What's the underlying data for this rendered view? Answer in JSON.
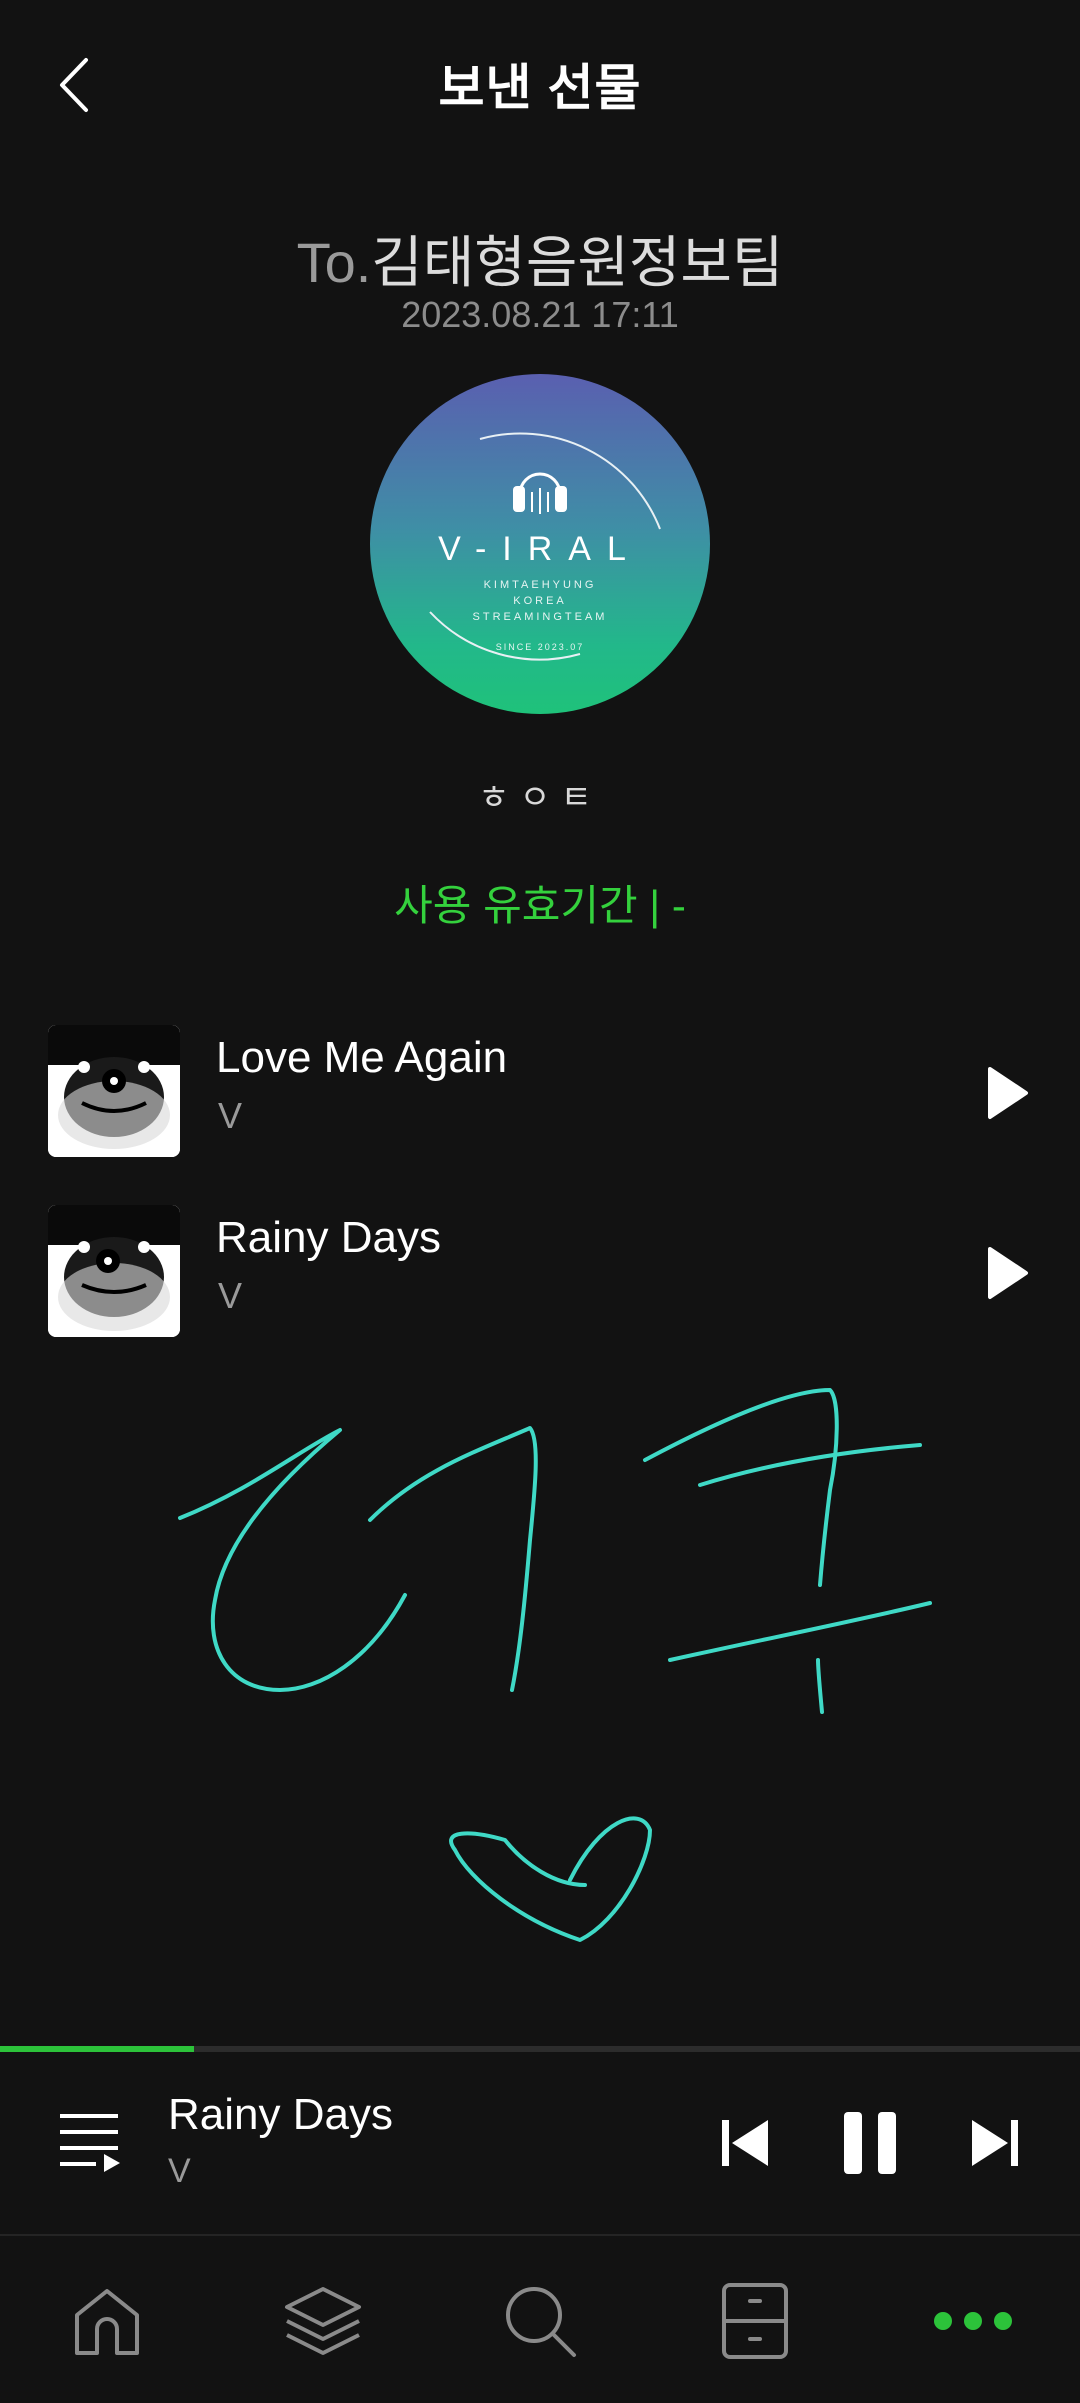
{
  "header": {
    "title": "보낸 선물"
  },
  "gift": {
    "to_prefix": "To.",
    "recipient": "김태형음원정보팀",
    "date": "2023.08.21 17:11",
    "sender": "ㅎㅇㅌ",
    "validity": "사용 유효기간 |  -"
  },
  "logo": {
    "brand": "V-IRAL",
    "line1": "KIMTAEHYUNG",
    "line2": "KOREA",
    "line3": "STREAMINGTEAM",
    "since": "SINCE 2023.07"
  },
  "tracks": [
    {
      "title": "Love Me Again",
      "artist": "V"
    },
    {
      "title": "Rainy Days",
      "artist": "V"
    }
  ],
  "player": {
    "title": "Rainy Days",
    "artist": "V",
    "progress": 0.18,
    "state": "playing"
  },
  "colors": {
    "accent": "#2cc33a",
    "validity": "#34d13d",
    "handwriting": "#3fd9c6"
  },
  "nav": {
    "items": [
      "home-icon",
      "library-icon",
      "search-icon",
      "storage-icon",
      "more-icon"
    ],
    "active": "more-icon"
  }
}
